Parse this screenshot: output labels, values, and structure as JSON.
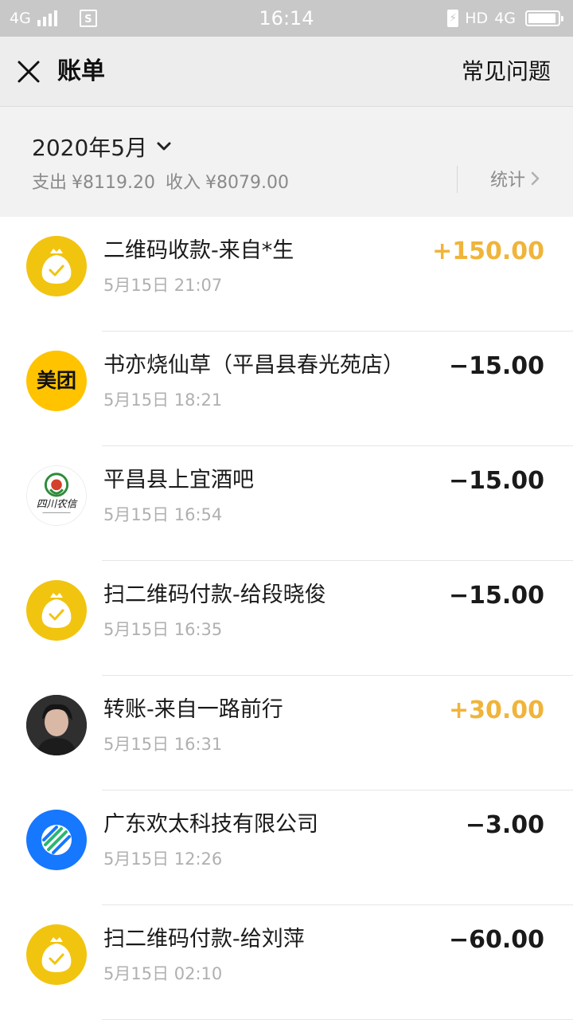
{
  "status_bar": {
    "network": "4G",
    "time": "16:14",
    "hd_label": "HD",
    "network_right": "4G",
    "sim_icon": "sim-card-icon",
    "battery_level": 0.95
  },
  "header": {
    "title": "账单",
    "faq_label": "常见问题"
  },
  "summary": {
    "month": "2020年5月",
    "expense_label": "支出",
    "expense_value": "¥8119.20",
    "income_label": "收入",
    "income_value": "¥8079.00",
    "stats_label": "统计"
  },
  "colors": {
    "income_amount": "#f0b43a",
    "expense_amount": "#1a1a1a",
    "moneybag_avatar": "#f1c40f",
    "meituan_avatar": "#ffc300",
    "company_avatar": "#1677ff"
  },
  "transactions": [
    {
      "name": "二维码收款-来自*生",
      "time": "5月15日 21:07",
      "amount": "+150.00",
      "icon": "money-bag-icon",
      "type": "income"
    },
    {
      "name": "书亦烧仙草（平昌县春光苑店）",
      "time": "5月15日 18:21",
      "amount": "−15.00",
      "icon": "meituan-logo",
      "type": "expense",
      "logo_text": "美团"
    },
    {
      "name": "平昌县上宜酒吧",
      "time": "5月15日 16:54",
      "amount": "−15.00",
      "icon": "sichuan-rural-credit-logo",
      "type": "expense",
      "logo_text": "四川农信"
    },
    {
      "name": "扫二维码付款-给段晓俊",
      "time": "5月15日 16:35",
      "amount": "−15.00",
      "icon": "money-bag-icon",
      "type": "expense"
    },
    {
      "name": "转账-来自一路前行",
      "time": "5月15日 16:31",
      "amount": "+30.00",
      "icon": "user-avatar-photo",
      "type": "income"
    },
    {
      "name": "广东欢太科技有限公司",
      "time": "5月15日 12:26",
      "amount": "−3.00",
      "icon": "company-globe-logo",
      "type": "expense"
    },
    {
      "name": "扫二维码付款-给刘萍",
      "time": "5月15日 02:10",
      "amount": "−60.00",
      "icon": "money-bag-icon",
      "type": "expense"
    }
  ]
}
